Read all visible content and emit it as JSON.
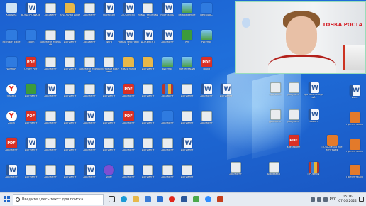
{
  "desktop_icons": [
    {
      "name": "Корзина",
      "type": "trash",
      "col": 0,
      "row": 0
    },
    {
      "name": "ВОРДПРОФИЛЬ",
      "type": "word",
      "col": 1,
      "row": 0
    },
    {
      "name": "документ",
      "type": "doc",
      "col": 2,
      "row": 0
    },
    {
      "name": "Начальная школа",
      "type": "folder",
      "col": 3,
      "row": 0
    },
    {
      "name": "Документ",
      "type": "doc",
      "col": 4,
      "row": 0
    },
    {
      "name": "протокол",
      "type": "word",
      "col": 5,
      "row": 0
    },
    {
      "name": "ДОКУМЕНТ",
      "type": "word",
      "col": 6,
      "row": 0
    },
    {
      "name": "Новый текстовый",
      "type": "doc",
      "col": 7,
      "row": 0
    },
    {
      "name": "протоколы",
      "type": "word",
      "col": 8,
      "row": 0
    },
    {
      "name": "изображение",
      "type": "img",
      "col": 9,
      "row": 0
    },
    {
      "name": "PascalABC",
      "type": "app",
      "col": 10,
      "row": 0
    },
    {
      "name": "Microsoft Edge",
      "type": "app",
      "col": 0,
      "row": 1
    },
    {
      "name": "Zoom",
      "type": "app",
      "col": 1,
      "row": 1
    },
    {
      "name": "Документ Microsoft",
      "type": "doc",
      "col": 2,
      "row": 1
    },
    {
      "name": "Документ",
      "type": "doc",
      "col": 3,
      "row": 1
    },
    {
      "name": "документ",
      "type": "doc",
      "col": 4,
      "row": 1
    },
    {
      "name": "Word",
      "type": "word",
      "col": 5,
      "row": 1
    },
    {
      "name": "Новый текстовый",
      "type": "word",
      "col": 6,
      "row": 1
    },
    {
      "name": "ДОКУМЕНТ",
      "type": "word",
      "col": 7,
      "row": 1
    },
    {
      "name": "Документ",
      "type": "word",
      "col": 8,
      "row": 1
    },
    {
      "name": "Кл",
      "type": "green",
      "col": 9,
      "row": 1
    },
    {
      "name": "Рисунок",
      "type": "img",
      "col": 10,
      "row": 1
    },
    {
      "name": "WinRAR",
      "type": "app",
      "col": 0,
      "row": 2
    },
    {
      "name": "Отчет PDF",
      "type": "pdf",
      "col": 1,
      "row": 2
    },
    {
      "name": "Документ",
      "type": "doc",
      "col": 2,
      "row": 2
    },
    {
      "name": "Документ",
      "type": "doc",
      "col": 3,
      "row": 2
    },
    {
      "name": "Документ Microsoft",
      "type": "doc",
      "col": 4,
      "row": 2
    },
    {
      "name": "Текстовый документ",
      "type": "doc",
      "col": 5,
      "row": 2
    },
    {
      "name": "Новая папка",
      "type": "folder",
      "col": 6,
      "row": 2
    },
    {
      "name": "Документ",
      "type": "folder",
      "col": 7,
      "row": 2
    },
    {
      "name": "рисунок",
      "type": "img",
      "col": 8,
      "row": 2
    },
    {
      "name": "презентация",
      "type": "img",
      "col": 9,
      "row": 2
    },
    {
      "name": "Точка",
      "type": "pdf",
      "col": 10,
      "row": 2
    },
    {
      "name": "Яндекс",
      "type": "yandex",
      "col": 0,
      "row": 3
    },
    {
      "name": "Документ",
      "type": "green",
      "col": 1,
      "row": 3
    },
    {
      "name": "Документ",
      "type": "word",
      "col": 2,
      "row": 3
    },
    {
      "name": "Документ",
      "type": "doc",
      "col": 3,
      "row": 3
    },
    {
      "name": "Документ",
      "type": "doc",
      "col": 4,
      "row": 3
    },
    {
      "name": "Документ",
      "type": "word",
      "col": 5,
      "row": 3
    },
    {
      "name": "Документ",
      "type": "pdf",
      "col": 6,
      "row": 3
    },
    {
      "name": "Документ",
      "type": "doc",
      "col": 7,
      "row": 3
    },
    {
      "name": "документ",
      "type": "zip",
      "col": 8,
      "row": 3
    },
    {
      "name": "Документ",
      "type": "doc",
      "col": 9,
      "row": 3
    },
    {
      "name": "Документ",
      "type": "word",
      "col": 10,
      "row": 3
    },
    {
      "name": "Документ",
      "type": "word",
      "col": 11,
      "row": 3
    },
    {
      "name": "Zoom",
      "type": "yandex",
      "col": 0,
      "row": 4
    },
    {
      "name": "Документ",
      "type": "pdf",
      "col": 1,
      "row": 4
    },
    {
      "name": "Документ",
      "type": "doc",
      "col": 2,
      "row": 4
    },
    {
      "name": "Документ",
      "type": "doc",
      "col": 3,
      "row": 4
    },
    {
      "name": "Документ",
      "type": "word",
      "col": 4,
      "row": 4
    },
    {
      "name": "Документ",
      "type": "doc",
      "col": 5,
      "row": 4
    },
    {
      "name": "Документ",
      "type": "pdf",
      "col": 6,
      "row": 4
    },
    {
      "name": "Документ",
      "type": "doc",
      "col": 7,
      "row": 4
    },
    {
      "name": "Документ",
      "type": "app",
      "col": 8,
      "row": 4
    },
    {
      "name": "Документ",
      "type": "doc",
      "col": 9,
      "row": 4
    },
    {
      "name": "Документ",
      "type": "doc",
      "col": 10,
      "row": 4
    },
    {
      "name": "Документ",
      "type": "pdf",
      "col": 0,
      "row": 5
    },
    {
      "name": "Документ",
      "type": "word",
      "col": 1,
      "row": 5
    },
    {
      "name": "Документ",
      "type": "doc",
      "col": 2,
      "row": 5
    },
    {
      "name": "Документ",
      "type": "doc",
      "col": 3,
      "row": 5
    },
    {
      "name": "Документ",
      "type": "word",
      "col": 4,
      "row": 5
    },
    {
      "name": "Документ",
      "type": "doc",
      "col": 5,
      "row": 5
    },
    {
      "name": "Документ",
      "type": "doc",
      "col": 6,
      "row": 5
    },
    {
      "name": "Документ",
      "type": "doc",
      "col": 7,
      "row": 5
    },
    {
      "name": "Документ",
      "type": "doc",
      "col": 8,
      "row": 5
    },
    {
      "name": "Документ",
      "type": "word",
      "col": 9,
      "row": 5
    },
    {
      "name": "Документ",
      "type": "word",
      "col": 0,
      "row": 6
    },
    {
      "name": "Документ",
      "type": "doc",
      "col": 1,
      "row": 6
    },
    {
      "name": "Документ",
      "type": "doc",
      "col": 2,
      "row": 6
    },
    {
      "name": "Документ",
      "type": "doc",
      "col": 3,
      "row": 6
    },
    {
      "name": "Документ",
      "type": "word",
      "col": 4,
      "row": 6
    },
    {
      "name": "Viber",
      "type": "viber",
      "col": 5,
      "row": 6
    },
    {
      "name": "Документ",
      "type": "doc",
      "col": 6,
      "row": 6
    },
    {
      "name": "Документ",
      "type": "doc",
      "col": 7,
      "row": 6
    },
    {
      "name": "Документ",
      "type": "doc",
      "col": 8,
      "row": 6
    },
    {
      "name": "Документ",
      "type": "doc",
      "col": 9,
      "row": 6
    }
  ],
  "right_icons": [
    {
      "name": "протокол",
      "type": "doc",
      "slot": "r1a"
    },
    {
      "name": "Документ",
      "type": "doc",
      "slot": "r1b"
    },
    {
      "name": "протокол сводный",
      "type": "word",
      "slot": "r1c"
    },
    {
      "name": "Word",
      "type": "word",
      "slot": "r1d"
    },
    {
      "name": "Документ",
      "type": "doc",
      "slot": "r2a"
    },
    {
      "name": "Документ",
      "type": "doc",
      "slot": "r2b"
    },
    {
      "name": "Проект",
      "type": "word",
      "slot": "r2c"
    },
    {
      "name": "Презентация",
      "type": "orange",
      "slot": "r2d"
    },
    {
      "name": "ПОКАЗ МОД презентация",
      "type": "orange",
      "slot": "r3a"
    },
    {
      "name": "Презентация",
      "type": "orange",
      "slot": "r3b"
    },
    {
      "name": "электронн",
      "type": "pdf",
      "slot": "r3c"
    },
    {
      "name": "Документ",
      "type": "doc",
      "slot": "r4a"
    },
    {
      "name": "Биржавка",
      "type": "doc",
      "slot": "r4b"
    },
    {
      "name": "ПРОЕКТЫ",
      "type": "zip",
      "slot": "r4c"
    },
    {
      "name": "Презентация",
      "type": "orange",
      "slot": "r4d"
    }
  ],
  "taskbar": {
    "search_placeholder": "Введите здесь текст для поиска",
    "language": "РУС",
    "time": "15:16",
    "date": "07.06.2022"
  },
  "webcam": {
    "logo_text": "ТОЧКА РОСТА"
  }
}
